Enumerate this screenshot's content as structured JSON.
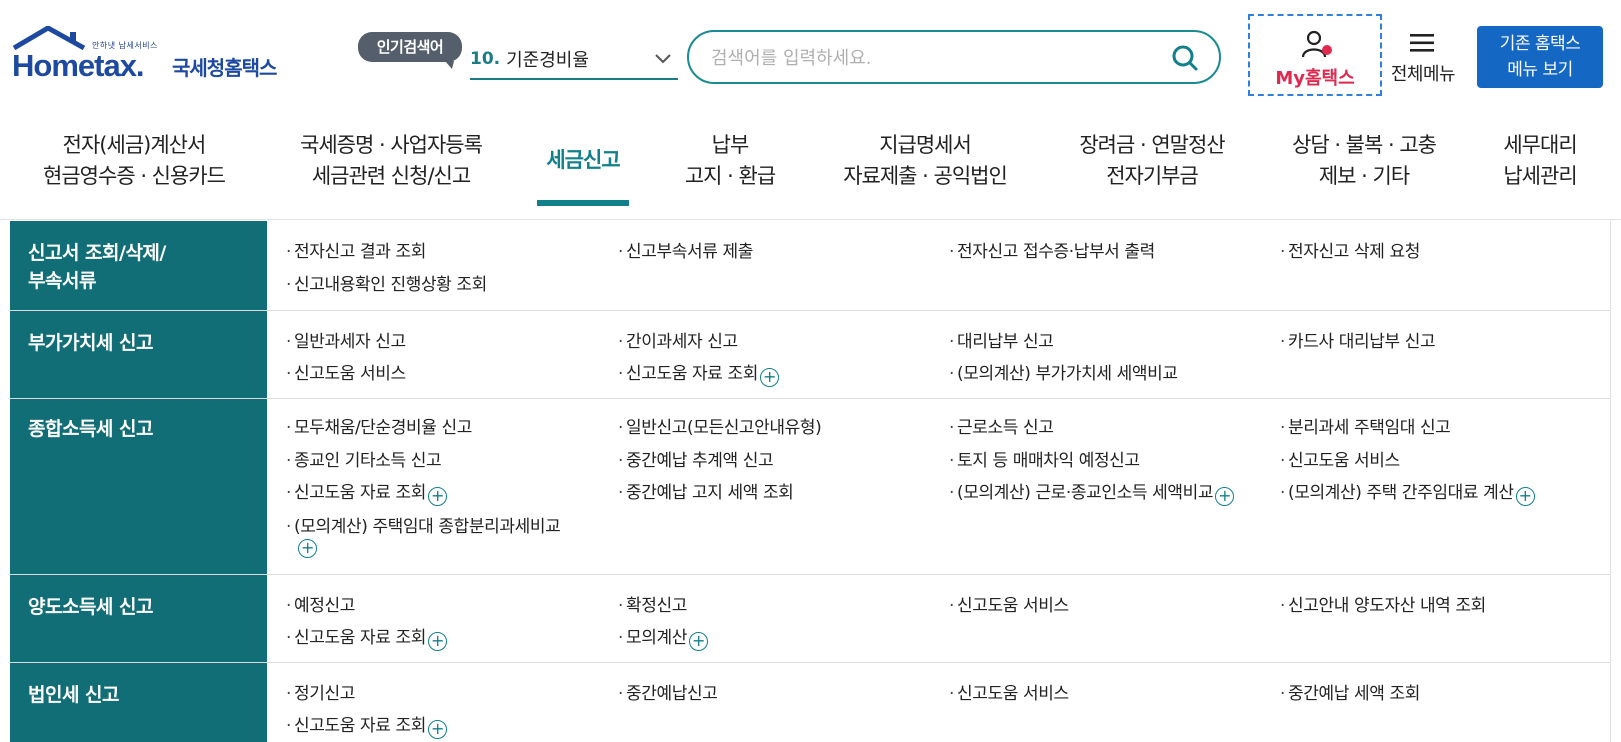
{
  "header": {
    "logo": {
      "tagline": "안하냇 납세서비스",
      "english": "Hometax.",
      "korean": "국세청홈택스"
    },
    "popular_badge": "인기검색어",
    "popular_rank": "10.",
    "popular_term": "기준경비율",
    "search_placeholder": "검색어를 입력하세요.",
    "my_hometax": "My홈택스",
    "all_menu": "전체메뉴",
    "old_hometax_line1": "기존 홈택스",
    "old_hometax_line2": "메뉴 보기"
  },
  "gnb": [
    {
      "line1": "전자(세금)계산서",
      "line2": "현금영수증 · 신용카드"
    },
    {
      "line1": "국세증명 · 사업자등록",
      "line2": "세금관련 신청/신고"
    },
    {
      "line1": "세금신고",
      "line2": ""
    },
    {
      "line1": "납부",
      "line2": "고지 · 환급"
    },
    {
      "line1": "지급명세서",
      "line2": "자료제출 · 공익법인"
    },
    {
      "line1": "장려금 · 연말정산",
      "line2": "전자기부금"
    },
    {
      "line1": "상담 · 불복 · 고충",
      "line2": "제보 · 기타"
    },
    {
      "line1": "세무대리",
      "line2": "납세관리"
    }
  ],
  "menu": {
    "rows": [
      {
        "title_line1": "신고서 조회/삭제/",
        "title_line2": "부속서류",
        "links": [
          "전자신고 결과 조회",
          "신고부속서류 제출",
          "전자신고 접수증·납부서 출력",
          "전자신고 삭제 요청",
          "신고내용확인 진행상황 조회"
        ]
      },
      {
        "title_line1": "부가가치세 신고",
        "links": [
          "일반과세자 신고",
          "간이과세자 신고",
          "대리납부 신고",
          "카드사 대리납부 신고",
          "신고도움 서비스",
          "신고도움 자료 조회",
          "(모의계산) 부가가치세 세액비교"
        ]
      },
      {
        "title_line1": "종합소득세 신고",
        "links": [
          "모두채움/단순경비율 신고",
          "일반신고(모든신고안내유형)",
          "근로소득 신고",
          "분리과세 주택임대 신고",
          "종교인 기타소득 신고",
          "중간예납 추계액 신고",
          "토지 등 매매차익 예정신고",
          "신고도움 서비스",
          "신고도움 자료 조회",
          "중간예납 고지 세액 조회",
          "(모의계산) 근로·종교인소득 세액비교",
          "(모의계산) 주택 간주임대료 계산",
          "(모의계산) 주택임대 종합분리과세비교"
        ]
      },
      {
        "title_line1": "양도소득세 신고",
        "links": [
          "예정신고",
          "확정신고",
          "신고도움 서비스",
          "신고안내 양도자산 내역 조회",
          "신고도움 자료 조회",
          "모의계산"
        ]
      },
      {
        "title_line1": "법인세 신고",
        "links": [
          "정기신고",
          "중간예납신고",
          "신고도움 서비스",
          "중간예납 세액 조회",
          "신고도움 자료 조회"
        ]
      }
    ]
  },
  "colors": {
    "teal": "#116e76",
    "accent": "#11808a",
    "pink": "#e0294f",
    "blue_button": "#1467c3"
  }
}
